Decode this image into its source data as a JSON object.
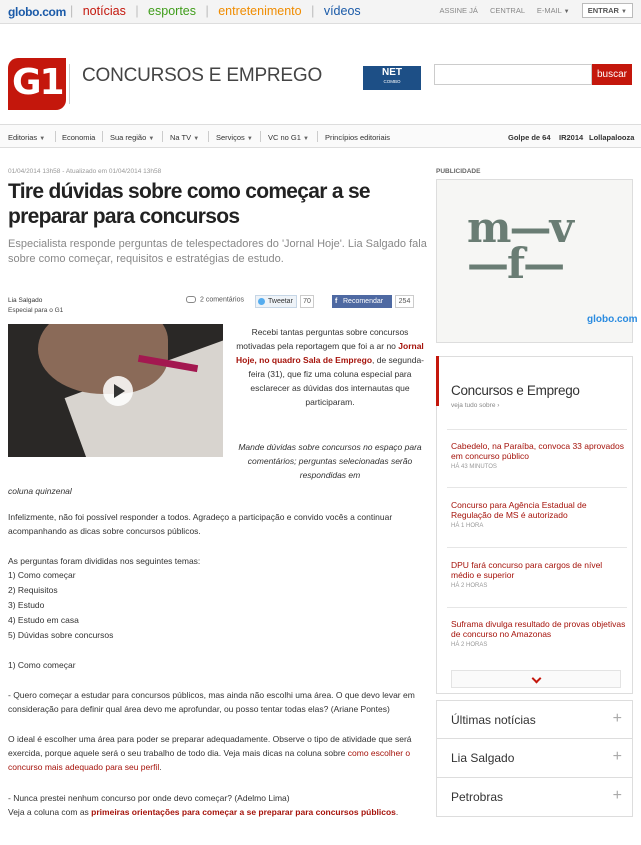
{
  "globalbar": {
    "brand": "globo.com",
    "links": [
      {
        "label": "notícias",
        "color": "#c4170c"
      },
      {
        "label": "esportes",
        "color": "#3f9d1a"
      },
      {
        "label": "entretenimento",
        "color": "#f08c00"
      },
      {
        "label": "vídeos",
        "color": "#1a5aa8"
      }
    ],
    "right_links": [
      "ASSINE JÁ",
      "CENTRAL",
      "E-MAIL"
    ],
    "enter": "ENTRAR"
  },
  "header": {
    "logo": "G1",
    "section_title": "CONCURSOS E EMPREGO",
    "ad_net": "NET",
    "ad_net_sub": "COMBO",
    "search_button": "buscar"
  },
  "nav": {
    "items": [
      "Editorias",
      "Economia",
      "Sua região",
      "Na TV",
      "Serviços",
      "VC no G1",
      "Princípios editoriais"
    ],
    "trends": [
      "Golpe de 64",
      "IR2014",
      "Lollapalooza"
    ]
  },
  "article": {
    "meta": "01/04/2014 13h58 - Atualizado em 01/04/2014 13h58",
    "headline": "Tire dúvidas sobre como começar a se preparar para concursos",
    "subtitle": "Especialista responde perguntas de telespectadores do 'Jornal Hoje'. Lia Salgado fala sobre como começar, requisitos e estratégias de estudo.",
    "author": "Lia Salgado",
    "author_role": "Especial para o G1",
    "comments": "2 comentários",
    "tweet": "Tweetar",
    "tweet_count": "70",
    "fb": "Recomendar",
    "fb_count": "254",
    "intro_1": "Recebi tantas perguntas sobre concursos motivadas pela reportagem que foi a ar no ",
    "intro_link": "Jornal Hoje, no quadro Sala de Emprego",
    "intro_2": ", de segunda-feira (31), que fiz uma coluna especial para esclarecer as dúvidas dos internautas que participaram.",
    "quote_1": "Mande dúvidas sobre concursos no espaço para comentários; perguntas selecionadas serão respondidas em",
    "quote_2": "coluna quinzenal",
    "para_1": "Infelizmente, não foi possível responder a todos. Agradeço a participação e convido vocês a continuar acompanhando as dicas sobre concursos públicos.",
    "topics_intro": "As perguntas foram divididas nos seguintes temas:",
    "topics": [
      "1) Como começar",
      "2) Requisitos",
      "3) Estudo",
      "4) Estudo em casa",
      "5) Dúvidas sobre concursos"
    ],
    "section_1": "1) Como começar",
    "q1": "- Quero começar a estudar para concursos públicos, mas ainda não escolhi uma área. O que devo levar em consideração para definir qual área devo me aprofundar, ou posso tentar todas elas?",
    "q1_author": "(Ariane Pontes)",
    "a1": "O ideal é escolher uma área para poder se preparar adequadamente. Observe o tipo de atividade que será exercida, porque aquele será o seu trabalho de todo dia. Veja mais dicas na coluna sobre ",
    "a1_link": "como escolher o concurso mais adequado para seu perfil",
    "a1_end": ".",
    "q2": "- Nunca prestei nenhum concurso por onde devo começar?",
    "q2_author": "(Adelmo Lima)",
    "a2": "Veja a coluna com as ",
    "a2_link": "primeiras orientações para começar a se preparar para concursos públicos",
    "a2_end": "."
  },
  "sidebar": {
    "ad_label": "PUBLICIDADE",
    "ad_line1": "m—v",
    "ad_line2": "—f—",
    "ad_logo": "globo.com",
    "box_title": "Concursos e Emprego",
    "box_sub": "veja tudo sobre ›",
    "news": [
      {
        "title": "Cabedelo, na Paraíba, convoca 33 aprovados em concurso público",
        "time": "HÁ 43 MINUTOS"
      },
      {
        "title": "Concurso para Agência Estadual de Regulação de MS é autorizado",
        "time": "HÁ 1 HORA"
      },
      {
        "title": "DPU fará concurso para cargos de nível médio e superior",
        "time": "HÁ 2 HORAS"
      },
      {
        "title": "Suframa divulga resultado de provas objetivas de concurso no Amazonas",
        "time": "HÁ 2 HORAS"
      }
    ],
    "accordions": [
      "Últimas notícias",
      "Lia Salgado",
      "Petrobras"
    ]
  }
}
